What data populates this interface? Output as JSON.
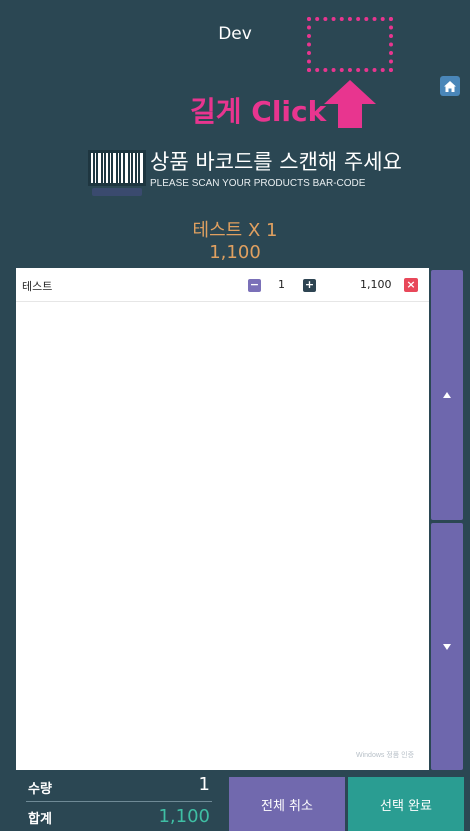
{
  "header": {
    "title": "Dev"
  },
  "annotation": {
    "hint_text": "길게 Click",
    "color": "#e8358f"
  },
  "scan": {
    "title_kr": "상품 바코드를 스캔해 주세요",
    "title_en": "PLEASE SCAN YOUR PRODUCTS BAR-CODE"
  },
  "summary": {
    "line1": "테스트 X 1",
    "line2": "1,100"
  },
  "items": [
    {
      "name": "테스트",
      "minus": "−",
      "qty": "1",
      "plus": "+",
      "price": "1,100",
      "delete": "×"
    }
  ],
  "watermark": "Windows 정품 인증",
  "footer": {
    "qty_label": "수량",
    "qty_value": "1",
    "total_label": "합계",
    "total_value": "1,100",
    "cancel_all": "전체 취소",
    "done": "선택 완료"
  },
  "icons": [
    "home-icon",
    "barcode-icon",
    "up-arrow-icon",
    "scroll-up-icon",
    "scroll-down-icon"
  ],
  "colors": {
    "background": "#2b4753",
    "accent_purple": "#7169ae",
    "accent_teal": "#2a9d92",
    "price_orange": "#e0a060"
  }
}
